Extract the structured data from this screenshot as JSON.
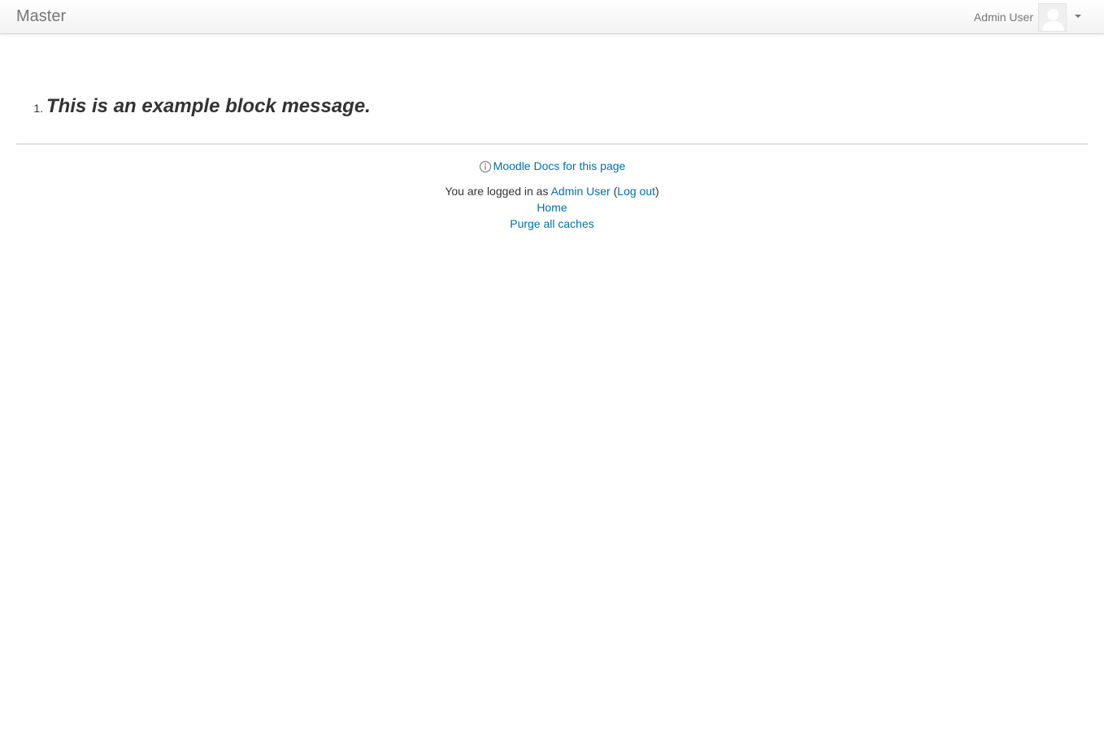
{
  "navbar": {
    "brand": "Master",
    "user_name": "Admin User"
  },
  "main": {
    "messages": [
      {
        "number": "1.",
        "text": "This is an example block message."
      }
    ]
  },
  "footer": {
    "docs_link": "Moodle Docs for this page",
    "logged_in_prefix": "You are logged in as ",
    "logged_in_user": "Admin User",
    "paren_open": " (",
    "logout_label": "Log out",
    "paren_close": ")",
    "home_link": "Home",
    "purge_link": "Purge all caches"
  },
  "colors": {
    "link": "#0070a8",
    "text": "#333333",
    "navbar_text": "#777777"
  }
}
